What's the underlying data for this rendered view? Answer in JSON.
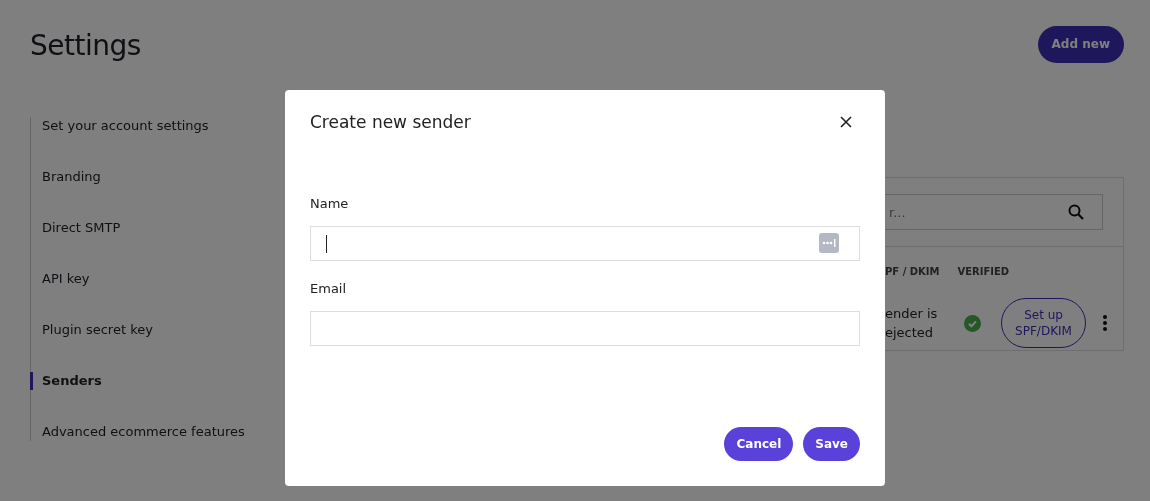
{
  "page": {
    "title": "Settings",
    "add_button": "Add new"
  },
  "sidebar": {
    "items": [
      {
        "label": "Set your account settings",
        "selected": false
      },
      {
        "label": "Branding",
        "selected": false
      },
      {
        "label": "Direct SMTP",
        "selected": false
      },
      {
        "label": "API key",
        "selected": false
      },
      {
        "label": "Plugin secret key",
        "selected": false
      },
      {
        "label": "Senders",
        "selected": true
      },
      {
        "label": "Advanced ecommerce features",
        "selected": false
      }
    ]
  },
  "senders_table": {
    "search_placeholder": "r...",
    "columns": [
      "PF / DKIM",
      "VERIFIED"
    ],
    "rows": [
      {
        "status": "ender is ejected",
        "verified": true,
        "action": "Set up SPF/DKIM"
      }
    ]
  },
  "dialog": {
    "title": "Create new sender",
    "fields": [
      {
        "label": "Name",
        "focused": true,
        "autofill_icon": true
      },
      {
        "label": "Email",
        "focused": false,
        "autofill_icon": false
      }
    ],
    "buttons": [
      "Cancel",
      "Save"
    ]
  }
}
